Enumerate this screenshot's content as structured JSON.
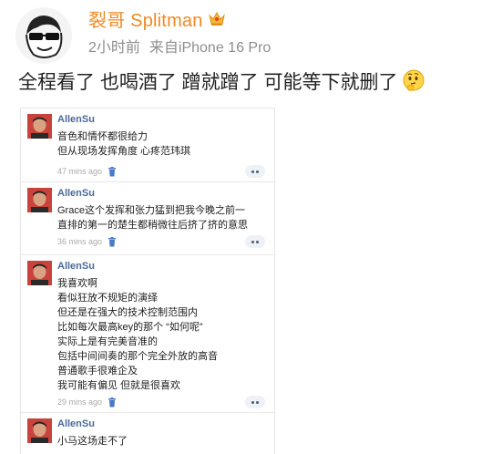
{
  "post": {
    "author_name": "裂哥 Splitman",
    "time": "2小时前",
    "source": "来自iPhone 16 Pro",
    "text": "全程看了 也喝酒了 蹭就蹭了 可能等下就删了",
    "author_icon": "cartoon-face-icon",
    "badge_icon": "crown-icon",
    "emoji_icon": "thinking-face-emoji"
  },
  "comments": [
    {
      "user": "AllenSu",
      "lines": [
        "音色和情怀都很给力",
        "但从现场发挥角度 心疼范玮琪"
      ],
      "time": "47 mins ago"
    },
    {
      "user": "AllenSu",
      "lines": [
        "Grace这个发挥和张力猛到把我今晚之前一",
        "直排的第一的楚生都稍微往后挤了挤的意思"
      ],
      "time": "36 mins ago"
    },
    {
      "user": "AllenSu",
      "lines": [
        "我喜欢啊",
        "看似狂放不规矩的演绎",
        "但还是在强大的技术控制范围内",
        "比如每次最高key的那个 “如何呢”",
        "实际上是有完美音准的",
        "包括中间间奏的那个完全外放的高音",
        "普通歌手很难企及",
        "我可能有偏见 但就是很喜欢"
      ],
      "time": "29 mins ago"
    },
    {
      "user": "AllenSu",
      "lines": [
        "小马这场走不了"
      ],
      "time": ""
    }
  ],
  "colors": {
    "author_name": "#f08a24",
    "comment_user": "#4a6a9a",
    "meta": "#8e8e8e",
    "trash": "#4a78c8"
  }
}
